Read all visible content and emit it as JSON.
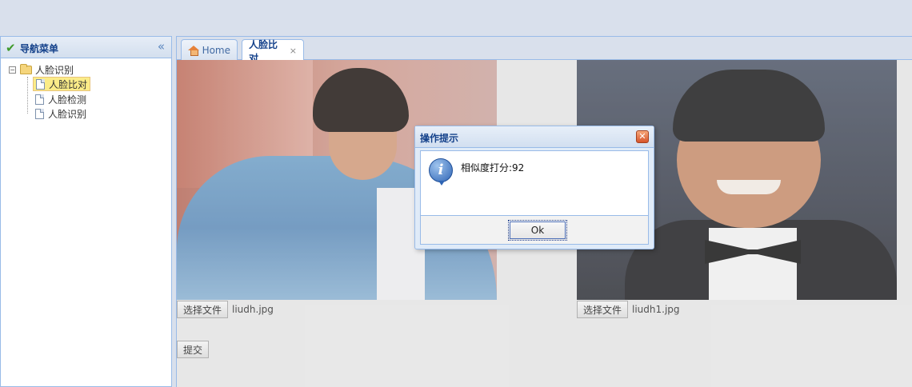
{
  "west": {
    "title": "导航菜单",
    "collapse_icon": "«",
    "tree": {
      "root_label": "人脸识别",
      "root_toggle": "−",
      "items": [
        {
          "label": "人脸比对",
          "selected": true
        },
        {
          "label": "人脸检测",
          "selected": false
        },
        {
          "label": "人脸识别",
          "selected": false
        }
      ]
    }
  },
  "tabs": [
    {
      "label": "Home",
      "icon": "home-icon"
    },
    {
      "label": "人脸比对",
      "close": "×",
      "active": true
    }
  ],
  "content": {
    "file1": {
      "button": "选择文件",
      "name": "liudh.jpg"
    },
    "file2": {
      "button": "选择文件",
      "name": "liudh1.jpg"
    },
    "submit": "提交"
  },
  "dialog": {
    "title": "操作提示",
    "close": "✕",
    "icon": "info-icon",
    "message": "相似度打分:92",
    "ok": "Ok"
  }
}
